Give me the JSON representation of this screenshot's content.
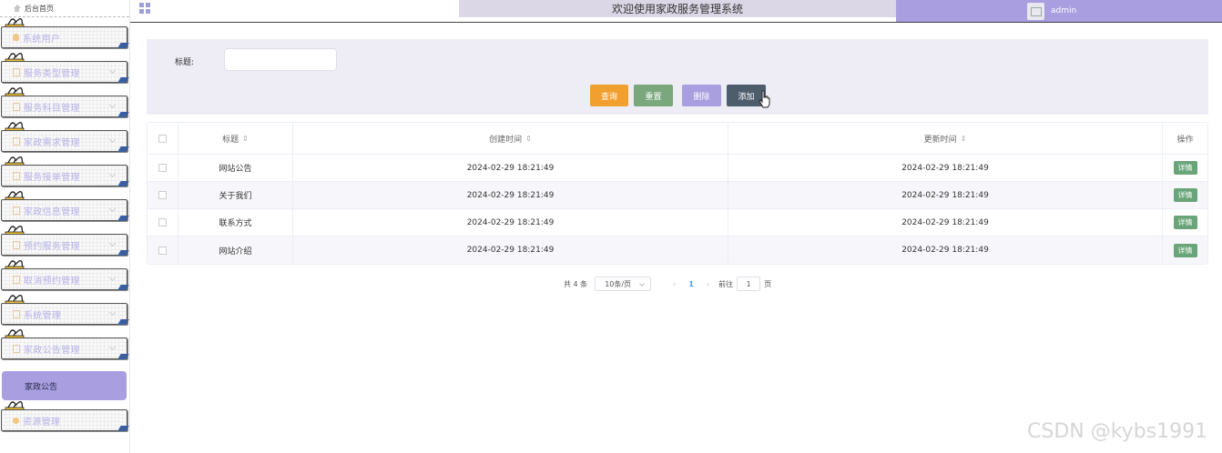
{
  "sidebar": {
    "home_label": "后台首页",
    "items": [
      {
        "label": "系统用户",
        "icon": "user-icon"
      },
      {
        "label": "服务类型管理",
        "icon": "doc-icon"
      },
      {
        "label": "服务科目管理",
        "icon": "doc-icon"
      },
      {
        "label": "家政需求管理",
        "icon": "doc-icon"
      },
      {
        "label": "服务接单管理",
        "icon": "doc-icon"
      },
      {
        "label": "家政信息管理",
        "icon": "doc-icon"
      },
      {
        "label": "预约服务管理",
        "icon": "doc-icon"
      },
      {
        "label": "取消预约管理",
        "icon": "doc-icon"
      },
      {
        "label": "系统管理",
        "icon": "doc-icon"
      },
      {
        "label": "家政公告管理",
        "icon": "doc-icon"
      },
      {
        "label": "资源管理",
        "icon": "sun-icon"
      }
    ],
    "active_sub": "家政公告"
  },
  "header": {
    "title": "欢迎使用家政服务管理系统",
    "user": "admin"
  },
  "filter": {
    "label": "标题:",
    "value": "",
    "buttons": {
      "query": "查询",
      "reset": "重置",
      "delete": "删除",
      "add": "添加"
    }
  },
  "table": {
    "headers": {
      "title": "标题",
      "created": "创建时间",
      "updated": "更新时间",
      "ops": "操作"
    },
    "sort_glyph": "⇕",
    "rows": [
      {
        "title": "网站公告",
        "created": "2024-02-29 18:21:49",
        "updated": "2024-02-29 18:21:49",
        "action": "详情"
      },
      {
        "title": "关于我们",
        "created": "2024-02-29 18:21:49",
        "updated": "2024-02-29 18:21:49",
        "action": "详情"
      },
      {
        "title": "联系方式",
        "created": "2024-02-29 18:21:49",
        "updated": "2024-02-29 18:21:49",
        "action": "详情"
      },
      {
        "title": "网站介绍",
        "created": "2024-02-29 18:21:49",
        "updated": "2024-02-29 18:21:49",
        "action": "详情"
      }
    ]
  },
  "pagination": {
    "total": "共 4 条",
    "page_size": "10条/页",
    "prev": "‹",
    "current": "1",
    "next": "›",
    "goto_label": "前往",
    "goto_value": "1",
    "page_unit": "页"
  },
  "watermark": "CSDN @kybs1991",
  "colors": {
    "accent": "#a89ee0",
    "query": "#f1a030",
    "reset": "#7aa87c",
    "add": "#4e5d6c",
    "detail": "#6aa57a"
  }
}
